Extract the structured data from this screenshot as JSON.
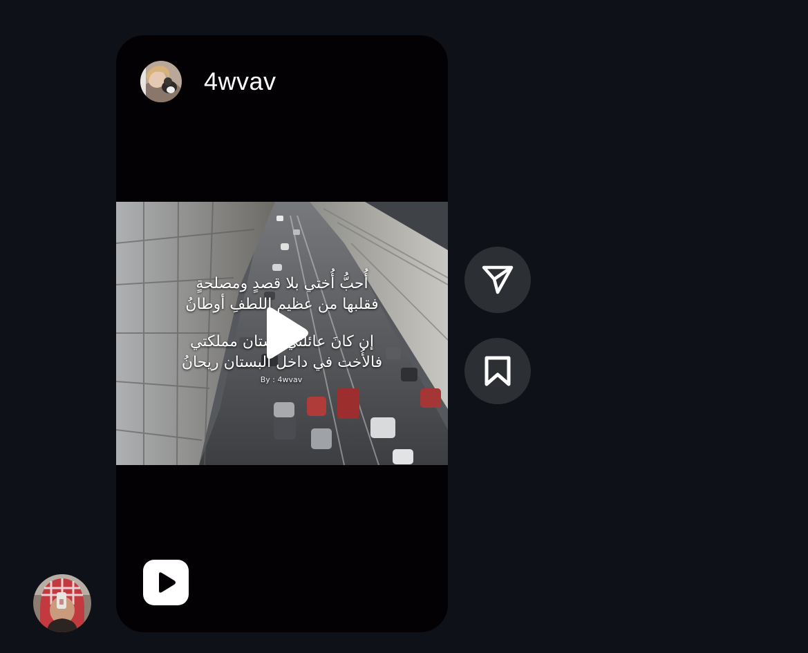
{
  "post": {
    "author": {
      "username": "4wvav",
      "avatar": "author-avatar-photo"
    },
    "video": {
      "caption_lines": [
        "أُحبُّ أُختي بلا قصدٍ ومصلحةٍ",
        "فقلبها من عظيم اللطفِ أوطانُ",
        "إن كانَ عائلتي بستان مملكتي",
        "فالأُخت في داخل البستان ريحانُ"
      ],
      "credit": "By : 4wvav",
      "play_icon": "play-icon"
    },
    "media_type_icon": "reel-icon"
  },
  "actions": {
    "share_icon": "send-icon",
    "save_icon": "bookmark-icon"
  },
  "current_user": {
    "avatar": "user-avatar-photo"
  },
  "colors": {
    "background": "#0e1117",
    "card": "#030104",
    "action_button": "#2c2f34",
    "text": "#ffffff"
  }
}
